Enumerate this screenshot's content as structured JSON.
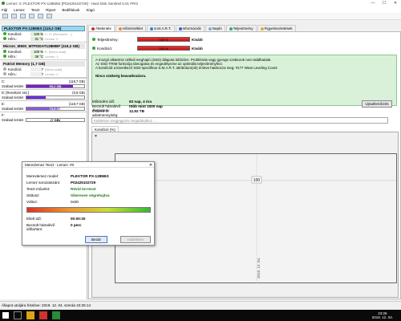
{
  "window": {
    "title": "Lemez: 0, PLEXTOR PX-128M6S [P02425102729] - Hard Disk Sentinel 5.01 PRO",
    "min": "—",
    "max": "☐",
    "close": "✕"
  },
  "menu": [
    "Fájl",
    "Lemez",
    "Teszt",
    "Riport",
    "Beállítások",
    "Súgó"
  ],
  "tabs": [
    "Áttekintés",
    "Hőmérséklet",
    "S.M.A.R.T.",
    "Információk",
    "Napló",
    "Teljesítmény",
    "Figyelmeztetések"
  ],
  "disks": [
    {
      "name": "PLEXTOR PX-128M6S (119,2 GB)",
      "sub": "Lemez: 0",
      "rows": [
        {
          "label": "Kondíció:",
          "value": "100 %",
          "extra": "C: D: [Rendszer ...]"
        },
        {
          "label": "Hőm.:",
          "value": "31 °C",
          "extra": "[PLEXTOR...]"
        }
      ]
    },
    {
      "name": "Micron_M600_MTFDDAT128MBF (119,2 GB)",
      "sub": "Lemez: 1",
      "rows": [
        {
          "label": "Kondíció:",
          "value": "100 %",
          "extra": "E: [Nincs adat]"
        },
        {
          "label": "Hőm.:",
          "value": "36 °C",
          "extra": "[Nincs adat]"
        }
      ]
    },
    {
      "name": "Patriot Memory (1,7 GB)",
      "sub": "Lemez: 2",
      "rows": [
        {
          "label": "Kondíció:",
          "value": "?",
          "extra": "[Nincs adat]"
        },
        {
          "label": "Hőm.:",
          "value": "?",
          "extra": "[PATRIOT]"
        }
      ]
    }
  ],
  "partitions": [
    {
      "name": "C:",
      "size": "(118,7 GB)",
      "label": "Szabad terület",
      "value": "95,2 GB",
      "pct": 80,
      "color": "#7a1bd6"
    },
    {
      "name": "D: [Rendszer ssz.]",
      "size": "(0,6 GB)",
      "label": "Szabad terület",
      "value": "0,2 GB",
      "pct": 33,
      "color": "#6a2de0"
    },
    {
      "name": "E:",
      "size": "(118,7 GB)",
      "label": "Szabad terület",
      "value": "70,5 GB",
      "pct": 59,
      "color": "#8a5bd8"
    },
    {
      "name": "F:",
      "size": "(7 GB)",
      "label": "Szabad terület",
      "value": "(7 GB)",
      "pct": 0,
      "color": "#eee"
    }
  ],
  "status": {
    "health_label": "Teljesítmény:",
    "health_pct": "100 %",
    "health_text": "Kiváló",
    "cond_label": "Kondíció:",
    "cond_pct": "100 %",
    "cond_text": "Kiváló"
  },
  "message": [
    "A mozgó alkatrész nélküli meghajtó (SSD) állapota kitűnően. Problémás vagy gyenge szektorok nem találhatóak.",
    "Az SSD TRIM funkciója támogatva és engedélyezve az optimális teljesítményhez.",
    "A kondíciót a következő SSD-specifikus S.M.A.R.T. attribútum(ok) érintve határozza meg: #177 Wear Leveling Count",
    "Nincs szükség beavatkozásra."
  ],
  "info": [
    {
      "k": "Működési idő:",
      "v": "63 nap, 4 óra"
    },
    {
      "k": "Becsült hátralévő élettartam:",
      "v": "több mint 1000 nap"
    },
    {
      "k": "Összes írt adatmennyiség:",
      "v": "12,92 TB"
    }
  ],
  "update_button": "Újraellenőrzés",
  "comment_placeholder": "Kattintson megjegyzés megadásához ....",
  "chart_tab": "Kondíció (%)",
  "chart_data": {
    "type": "line",
    "series": [
      {
        "values": [
          100
        ]
      }
    ],
    "x": [
      "2019. 12. 04."
    ],
    "point_label": "100"
  },
  "dialog": {
    "title": "Merevlemez Teszt - Lemez: #0",
    "rows": [
      {
        "k": "Merevlemez model:",
        "v": "PLEXTOR PX-128M6S"
      },
      {
        "k": "Lemez sorozatszám:",
        "v": "P02425102729"
      },
      {
        "k": "Teszt művelet:",
        "v": "Rövid ön-teszt"
      },
      {
        "k": "Státusz:",
        "v": "Sikeresen végrehajtva"
      },
      {
        "k": "Változ:",
        "v": "0x00"
      }
    ],
    "elapsed_label": "Eltelt idő:",
    "elapsed": "00:00:30",
    "remaining_label": "Becsült hátralévő időtartam:",
    "remaining": "0 perc",
    "close": "Bezár",
    "hide": "Háttérben"
  },
  "statusbar": "Állapot utoljára frissítve: 2019. 12. 04. szerda 23:25:14",
  "clock": {
    "time": "23:26",
    "date": "2019. 12. 04."
  }
}
